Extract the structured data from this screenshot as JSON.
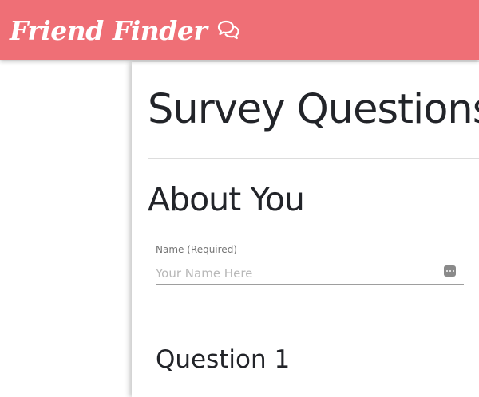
{
  "navbar": {
    "brand_text": "Friend Finder",
    "brand_icon": "comments-icon",
    "background_color": "#ef6f76"
  },
  "survey": {
    "title": "Survey Questions",
    "section_heading": "About You",
    "name_field": {
      "label": "Name (Required)",
      "placeholder": "Your Name Here",
      "value": ""
    },
    "question_heading": "Question 1"
  }
}
